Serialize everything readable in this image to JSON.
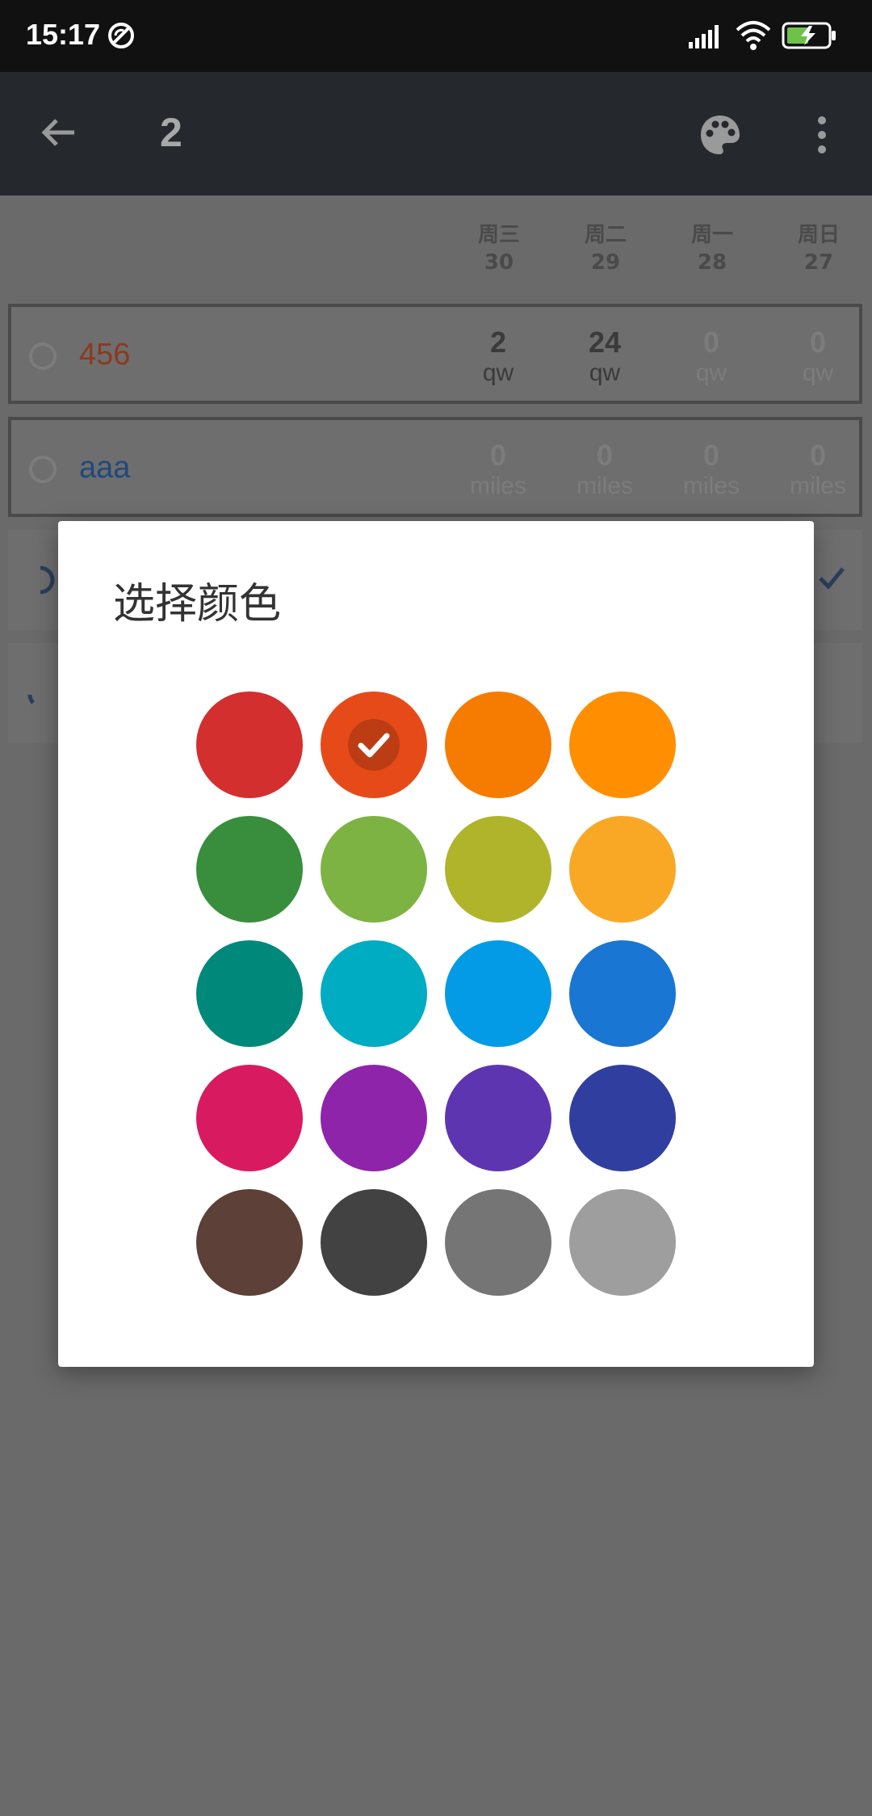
{
  "status_bar": {
    "time": "15:17",
    "icons": [
      "sync-disabled-icon",
      "signal-icon",
      "wifi-icon",
      "battery-charging-icon"
    ]
  },
  "app_bar": {
    "title": "2",
    "icons": [
      "back-arrow-icon",
      "palette-icon",
      "more-vert-icon"
    ]
  },
  "day_headers": [
    {
      "weekday": "周三",
      "date": "30"
    },
    {
      "weekday": "周二",
      "date": "29"
    },
    {
      "weekday": "周一",
      "date": "28"
    },
    {
      "weekday": "周日",
      "date": "27"
    }
  ],
  "habits": [
    {
      "name": "456",
      "color": "#c2401c",
      "cells": [
        {
          "value": "2",
          "unit": "qw",
          "active": true
        },
        {
          "value": "24",
          "unit": "qw",
          "active": true
        },
        {
          "value": "0",
          "unit": "qw",
          "active": false
        },
        {
          "value": "0",
          "unit": "qw",
          "active": false
        }
      ]
    },
    {
      "name": "aaa",
      "color": "#1b5ea8",
      "cells": [
        {
          "value": "0",
          "unit": "miles",
          "active": false
        },
        {
          "value": "0",
          "unit": "miles",
          "active": false
        },
        {
          "value": "0",
          "unit": "miles",
          "active": false
        },
        {
          "value": "0",
          "unit": "miles",
          "active": false
        }
      ]
    }
  ],
  "dialog": {
    "title": "选择颜色",
    "selected_index": 1,
    "colors": [
      "#d32f2f",
      "#e64a19",
      "#f57c00",
      "#ff8f00",
      "#388e3c",
      "#7cb342",
      "#afb42b",
      "#f9a825",
      "#00897b",
      "#00acc1",
      "#039be5",
      "#1976d2",
      "#d81b60",
      "#8e24aa",
      "#5e35b1",
      "#303f9f",
      "#5d4037",
      "#424242",
      "#757575",
      "#9e9e9e"
    ]
  }
}
